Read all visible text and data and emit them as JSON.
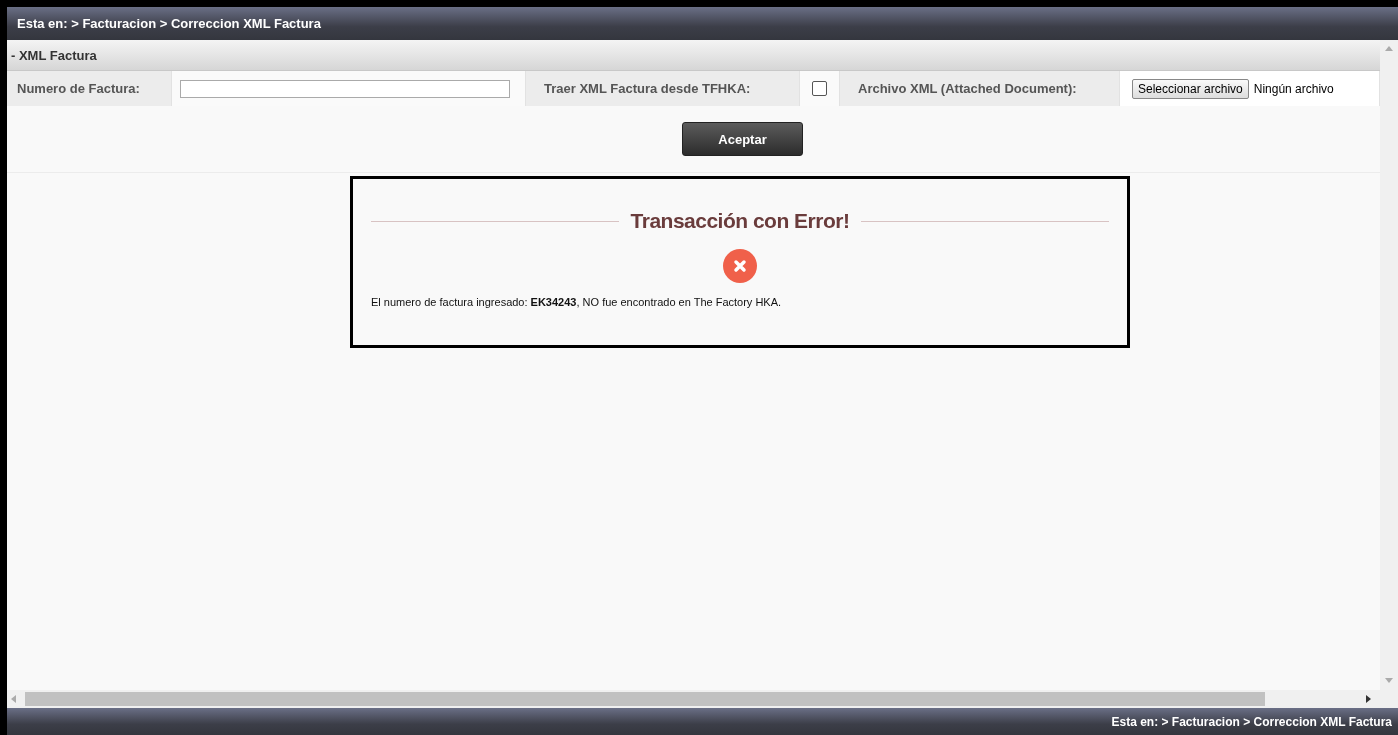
{
  "breadcrumb": "Esta en: > Facturacion > Correccion XML Factura",
  "section": {
    "title": "- XML Factura"
  },
  "form": {
    "invoice_label": "Numero de Factura:",
    "fetch_label": "Traer XML Factura desde TFHKA:",
    "fetch_checked": false,
    "file_label": "Archivo XML (Attached Document):",
    "file_button": "Seleccionar archivo",
    "file_status": "Ningún archivo"
  },
  "submit_button": "Aceptar",
  "dialog": {
    "title": "Transacción con Error!",
    "message": "El numero de factura ingresado: **EK34243**, NO fue encontrado en The Factory HKA."
  },
  "footer_breadcrumb": "Esta en: > Facturacion > Correccion XML Factura"
}
